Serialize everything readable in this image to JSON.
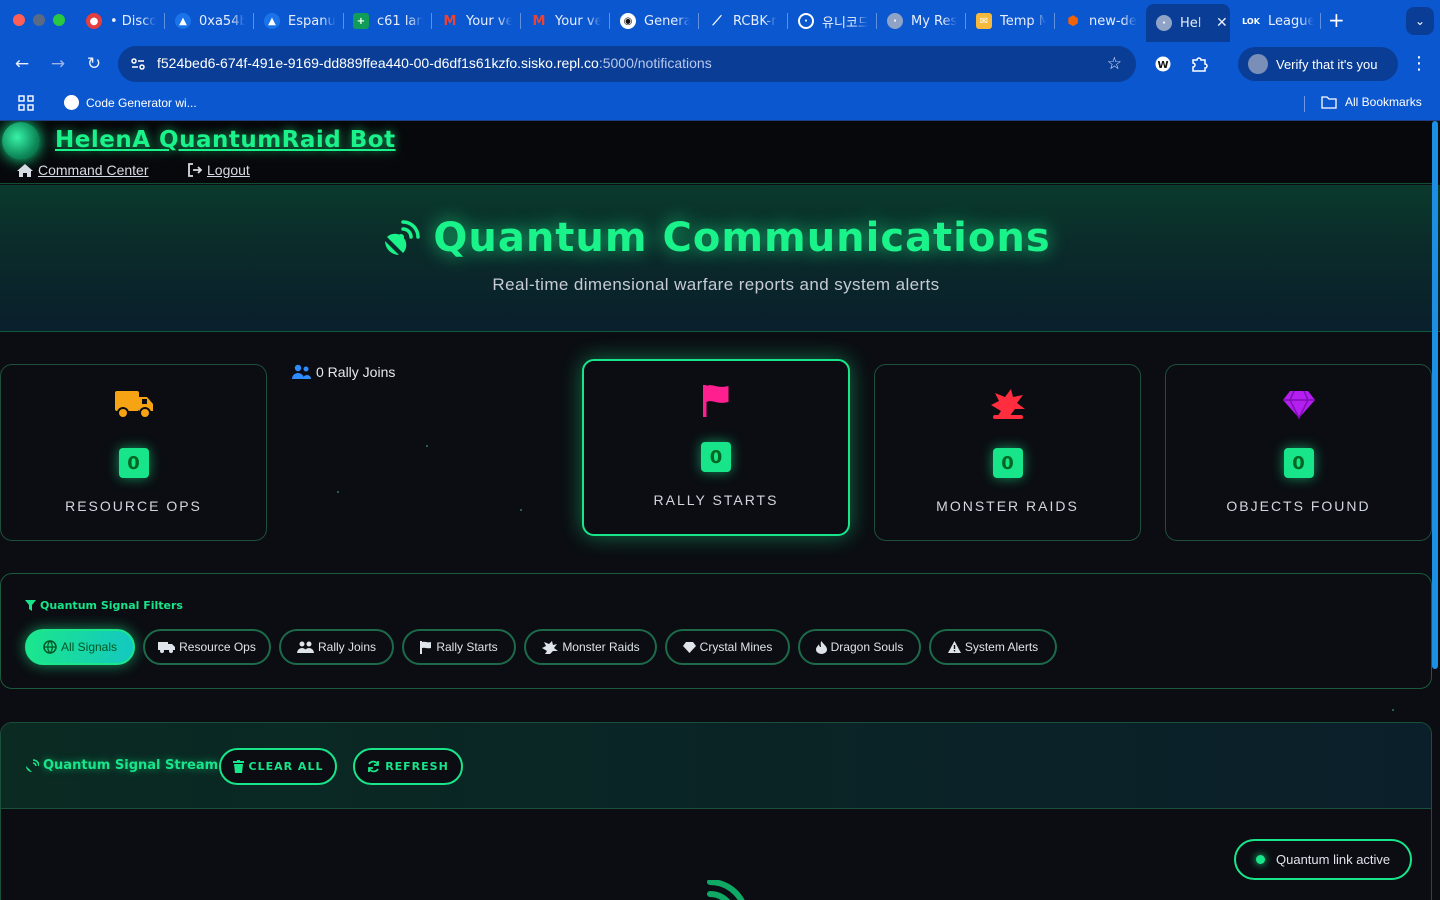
{
  "browser": {
    "tabs": [
      {
        "title": "• Disco",
        "icon": "discord-icon"
      },
      {
        "title": "0xa54b",
        "icon": "drive-icon"
      },
      {
        "title": "Espanu",
        "icon": "drive-icon"
      },
      {
        "title": "c61 lan",
        "icon": "sheets-icon"
      },
      {
        "title": "Your ve",
        "icon": "gmail-icon"
      },
      {
        "title": "Your ve",
        "icon": "gmail-icon"
      },
      {
        "title": "Genera",
        "icon": "github-icon"
      },
      {
        "title": "RCBK-r",
        "icon": "link-icon"
      },
      {
        "title": "유니코드",
        "icon": "globe-icon"
      },
      {
        "title": "My Res",
        "icon": "globe-icon"
      },
      {
        "title": "Temp M",
        "icon": "mail-icon"
      },
      {
        "title": "new-de",
        "icon": "replit-icon"
      },
      {
        "title": "Hel",
        "icon": "globe-icon",
        "active": true
      },
      {
        "title": "League",
        "icon": "lok-icon"
      }
    ],
    "url_host": "f524bed6-674f-491e-9169-dd889ffea440-00-d6df1s61kzfo.sisko.repl.co",
    "url_path": ":5000/notifications",
    "verify_label": "Verify that it's you",
    "bookmark_item": "Code Generator wi...",
    "all_bookmarks": "All Bookmarks"
  },
  "app": {
    "brand": "HelenA QuantumRaid Bot",
    "nav": {
      "command_center": "Command Center",
      "logout": "Logout"
    }
  },
  "hero": {
    "title": "Quantum Communications",
    "subtitle": "Real-time dimensional warfare reports and system alerts"
  },
  "stats": {
    "resource_ops": {
      "label": "RESOURCE OPS",
      "value": "0"
    },
    "rally_joins": {
      "text": "0 Rally Joins"
    },
    "rally_starts": {
      "label": "RALLY STARTS",
      "value": "0"
    },
    "monster_raids": {
      "label": "MONSTER RAIDS",
      "value": "0"
    },
    "objects_found": {
      "label": "OBJECTS FOUND",
      "value": "0"
    }
  },
  "filters": {
    "title": "Quantum Signal Filters",
    "items": [
      {
        "label": "All Signals",
        "icon": "globe-icon",
        "active": true
      },
      {
        "label": "Resource Ops",
        "icon": "truck-icon"
      },
      {
        "label": "Rally Joins",
        "icon": "users-icon"
      },
      {
        "label": "Rally Starts",
        "icon": "flag-icon"
      },
      {
        "label": "Monster Raids",
        "icon": "dragon-icon"
      },
      {
        "label": "Crystal Mines",
        "icon": "gem-icon"
      },
      {
        "label": "Dragon Souls",
        "icon": "fire-icon"
      },
      {
        "label": "System Alerts",
        "icon": "warning-icon"
      }
    ]
  },
  "stream": {
    "title": "Quantum Signal Stream",
    "clear_label": "CLEAR ALL",
    "refresh_label": "REFRESH"
  },
  "status": {
    "label": "Quantum link active"
  },
  "colors": {
    "accent": "#18e58a",
    "chrome": "#0b57d0",
    "truck": "#f6a413",
    "flag": "#ff1f8e",
    "dragon": "#ff2d3d",
    "gem": "#b41ef0"
  }
}
